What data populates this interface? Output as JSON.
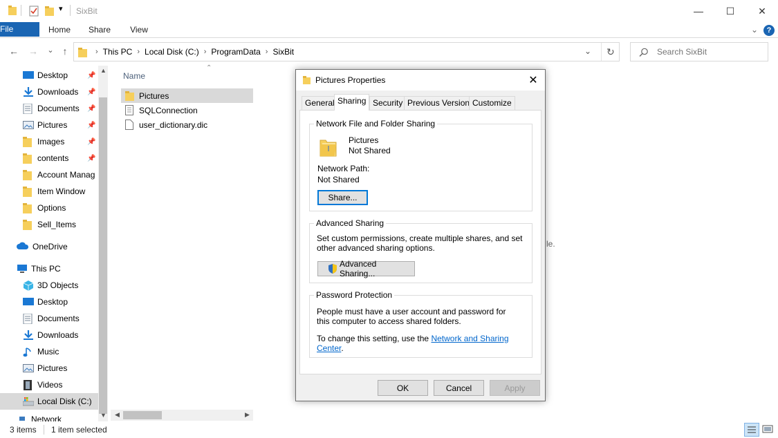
{
  "window": {
    "title": "SixBit",
    "minimize_glyph": "—",
    "maximize_glyph": "☐",
    "close_glyph": "✕"
  },
  "ribbon": {
    "tabs": [
      "File",
      "Home",
      "Share",
      "View"
    ],
    "expand_glyph": "⌄",
    "help_glyph": "?"
  },
  "address": {
    "back_glyph": "←",
    "forward_glyph": "→",
    "recent_glyph": "⌄",
    "up_glyph": "↑",
    "crumbs": [
      "This PC",
      "Local Disk (C:)",
      "ProgramData",
      "SixBit"
    ],
    "dropdown_glyph": "⌄",
    "refresh_glyph": "↻"
  },
  "search": {
    "placeholder": "Search SixBit"
  },
  "nav": {
    "quick_access": [
      "Desktop",
      "Downloads",
      "Documents",
      "Pictures",
      "Images",
      "contents",
      "Account Manag",
      "Item Window",
      "Options",
      "Sell_Items"
    ],
    "onedrive": "OneDrive",
    "this_pc": "This PC",
    "pc_items": [
      "3D Objects",
      "Desktop",
      "Documents",
      "Downloads",
      "Music",
      "Pictures",
      "Videos",
      "Local Disk (C:)"
    ],
    "network_partial": "Network"
  },
  "filelist": {
    "column_name": "Name",
    "files": [
      "Pictures",
      "SQLConnection",
      "user_dictionary.dic"
    ],
    "partial_text": "le."
  },
  "status": {
    "items_count": "3 items",
    "selected": "1 item selected"
  },
  "dialog": {
    "title": "Pictures Properties",
    "tabs": [
      "General",
      "Sharing",
      "Security",
      "Previous Versions",
      "Customize"
    ],
    "network_group": {
      "label": "Network File and Folder Sharing",
      "folder_name": "Pictures",
      "share_state": "Not Shared",
      "path_label": "Network Path:",
      "path_value": "Not Shared",
      "share_button": "Share..."
    },
    "advanced_group": {
      "label": "Advanced Sharing",
      "description": "Set custom permissions, create multiple shares, and set other advanced sharing options.",
      "button": "Advanced Sharing..."
    },
    "password_group": {
      "label": "Password Protection",
      "description": "People must have a user account and password for this computer to access shared folders.",
      "change_prefix": "To change this setting, use the ",
      "link": "Network and Sharing Center",
      "change_suffix": "."
    },
    "ok": "OK",
    "cancel": "Cancel",
    "apply": "Apply"
  },
  "colors": {
    "file_tab": "#1a65b3",
    "folder": "#f6cf5c",
    "selection": "#d9d9d9",
    "link": "#0066cc"
  }
}
